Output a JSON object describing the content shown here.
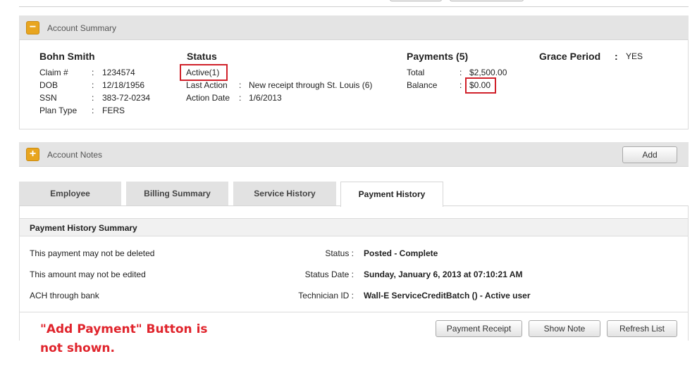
{
  "account_summary": {
    "title": "Account Summary",
    "toggle_icon": "minus-icon",
    "member": {
      "name": "Bohn Smith",
      "fields": [
        {
          "label": "Claim #",
          "value": "1234574"
        },
        {
          "label": "DOB",
          "value": "12/18/1956"
        },
        {
          "label": "SSN",
          "value": "383-72-0234"
        },
        {
          "label": "Plan Type",
          "value": "FERS"
        }
      ]
    },
    "status": {
      "heading": "Status",
      "value": "Active(1)",
      "last_action_label": "Last Action",
      "last_action_value": "New receipt through St. Louis (6)",
      "action_date_label": "Action Date",
      "action_date_value": "1/6/2013"
    },
    "payments": {
      "heading": "Payments (5)",
      "total_label": "Total",
      "total_value": "$2,500.00",
      "balance_label": "Balance",
      "balance_value": "$0.00"
    },
    "grace_period": {
      "label": "Grace Period",
      "value": "YES"
    },
    "separator": ":"
  },
  "account_notes": {
    "title": "Account Notes",
    "toggle_icon": "plus-icon",
    "add_label": "Add"
  },
  "tabs": [
    {
      "label": "Employee",
      "active": false
    },
    {
      "label": "Billing Summary",
      "active": false
    },
    {
      "label": "Service History",
      "active": false
    },
    {
      "label": "Payment History",
      "active": true
    }
  ],
  "payment_history": {
    "title": "Payment History Summary",
    "notes": [
      "This payment may not be deleted",
      "This amount may not be edited",
      "ACH through bank"
    ],
    "details": [
      {
        "label": "Status :",
        "value": "Posted - Complete"
      },
      {
        "label": "Status Date :",
        "value": "Sunday, January 6, 2013 at 07:10:21 AM"
      },
      {
        "label": "Technician ID :",
        "value": "Wall-E ServiceCreditBatch () - Active user"
      }
    ],
    "buttons": {
      "payment_receipt": "Payment Receipt",
      "show_note": "Show Note",
      "refresh_list": "Refresh List"
    }
  },
  "annotation": {
    "line1": "\"Add Payment\" Button is",
    "line2": "not shown."
  },
  "colors": {
    "highlight": "#d0212a",
    "toggle": "#e8a51f",
    "annotation": "#e0242c"
  }
}
